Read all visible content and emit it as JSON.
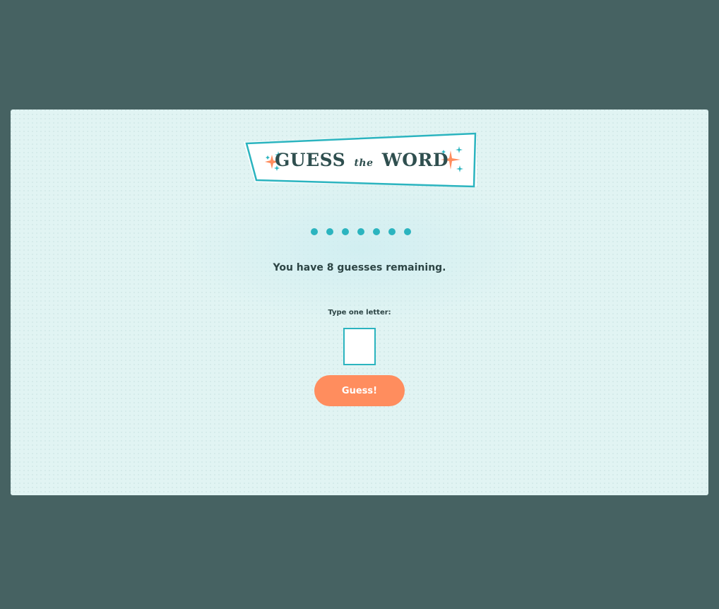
{
  "banner": {
    "title_part1": "GUESS",
    "title_part2": "the",
    "title_part3": "WORD"
  },
  "word_progress": {
    "hidden_letters": [
      "●",
      "●",
      "●",
      "●",
      "●",
      "●",
      "●"
    ]
  },
  "status": {
    "prefix": "You have ",
    "remaining_guesses": "8",
    "suffix": " guesses remaining."
  },
  "form": {
    "prompt_label": "Type one letter:",
    "letter_value": "",
    "button_label": "Guess!"
  },
  "colors": {
    "page_background": "#466262",
    "card_background": "#e1f4f3",
    "accent_teal": "#2bb4bf",
    "accent_orange": "#ff8d5e",
    "text_dark": "#2d4545"
  },
  "icons": {
    "left_sparkles": "sparkles-icon",
    "right_sparkles": "sparkles-icon"
  }
}
